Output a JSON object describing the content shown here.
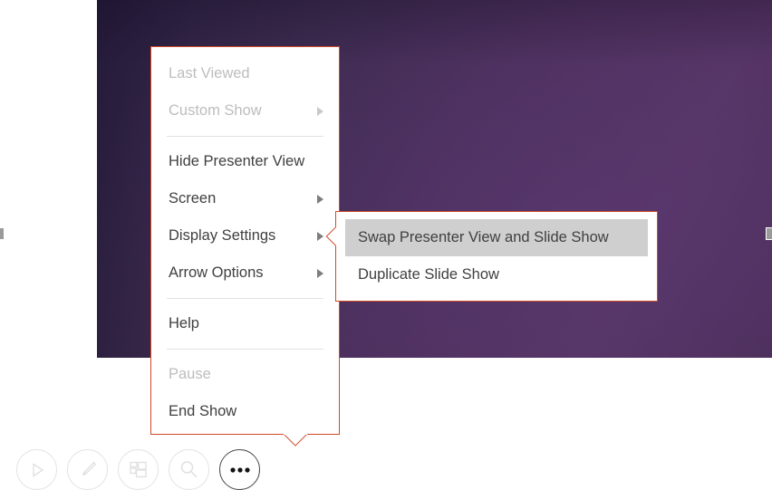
{
  "app": {
    "context": "PowerPoint Slide Show - Presenter View more options menu",
    "slide_background_color": "#4c2f5b",
    "menu_border_color": "#d04a28",
    "highlight_color": "#cfcfcf"
  },
  "more_options_menu": {
    "name": "More slide show options",
    "items": [
      {
        "id": "last-viewed",
        "label": "Last Viewed",
        "disabled": true,
        "submenu": false
      },
      {
        "id": "custom-show",
        "label": "Custom Show",
        "disabled": true,
        "submenu": true
      },
      {
        "id": "hide-presenter-view",
        "label": "Hide Presenter View",
        "disabled": false,
        "submenu": false
      },
      {
        "id": "screen",
        "label": "Screen",
        "disabled": false,
        "submenu": true
      },
      {
        "id": "display-settings",
        "label": "Display Settings",
        "disabled": false,
        "submenu": true
      },
      {
        "id": "arrow-options",
        "label": "Arrow Options",
        "disabled": false,
        "submenu": true
      },
      {
        "id": "help",
        "label": "Help",
        "disabled": false,
        "submenu": false
      },
      {
        "id": "pause",
        "label": "Pause",
        "disabled": true,
        "submenu": false
      },
      {
        "id": "end-show",
        "label": "End Show",
        "disabled": false,
        "submenu": false
      }
    ]
  },
  "display_settings_submenu": {
    "name": "Display Settings",
    "items": [
      {
        "id": "swap-presenter-view-and-slide-show",
        "label": "Swap Presenter View and Slide Show",
        "highlighted": true
      },
      {
        "id": "duplicate-slide-show",
        "label": "Duplicate Slide Show",
        "highlighted": false
      }
    ]
  },
  "toolbar": {
    "buttons": [
      {
        "id": "play",
        "icon": "play-icon",
        "active": false
      },
      {
        "id": "pen",
        "icon": "pen-icon",
        "active": false
      },
      {
        "id": "all-slides",
        "icon": "grid-icon",
        "active": false
      },
      {
        "id": "zoom",
        "icon": "magnifier-icon",
        "active": false
      },
      {
        "id": "more-options",
        "icon": "ellipsis-icon",
        "active": true
      }
    ]
  }
}
